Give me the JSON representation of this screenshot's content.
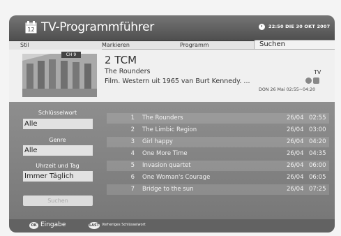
{
  "header": {
    "title": "TV-Programmführer",
    "datetime": "22:50 DIE 30 OKT 2007"
  },
  "menu": {
    "stil": "Stil",
    "markieren": "Markieren",
    "programm": "Programm",
    "suchen_tab": "Suchen"
  },
  "info": {
    "channel_badge": "CH 9",
    "channel": "2 TCM",
    "title": "The Rounders",
    "description": "Film. Western uit 1965 van Burt Kennedy. ...",
    "type": "TV",
    "schedule": "DON 26 Mai 02:55~04:20"
  },
  "filters": {
    "keyword_label": "Schlüsselwort",
    "keyword_value": "Alle",
    "genre_label": "Genre",
    "genre_value": "Alle",
    "time_label": "Uhrzeit und Tag",
    "time_value": "Immer Täglich",
    "search_button": "Suchen"
  },
  "results": [
    {
      "num": "1",
      "title": "The Rounders",
      "date": "26/04",
      "time": "02:55"
    },
    {
      "num": "2",
      "title": "The Limbic Region",
      "date": "26/04",
      "time": "03:00"
    },
    {
      "num": "3",
      "title": "Girl happy",
      "date": "26/04",
      "time": "04:20"
    },
    {
      "num": "4",
      "title": "One More Time",
      "date": "26/04",
      "time": "04:35"
    },
    {
      "num": "5",
      "title": "Invasion quartet",
      "date": "26/04",
      "time": "06:00"
    },
    {
      "num": "6",
      "title": "One Woman's Courage",
      "date": "26/04",
      "time": "06:05"
    },
    {
      "num": "7",
      "title": "Bridge to the sun",
      "date": "26/04",
      "time": "07:25"
    }
  ],
  "footer": {
    "ok_key": "OK",
    "ok_label": "Eingabe",
    "last_key": "LAST",
    "last_label": "Vorheriges Schlüsselwort"
  }
}
